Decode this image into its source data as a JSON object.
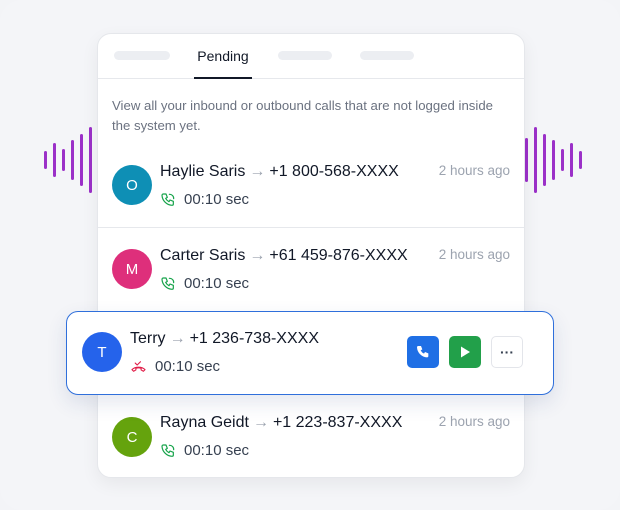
{
  "tabs": {
    "active_label": "Pending"
  },
  "description": "View all your inbound or outbound calls that are not logged inside the system yet.",
  "calls": [
    {
      "initial": "O",
      "name": "Haylie Saris",
      "arrow": "→",
      "number": "+1 800-568-XXXX",
      "duration": "00:10 sec",
      "time": "2 hours ago",
      "avatar_color": "#0e8fb5",
      "call_icon": "phone-call-icon",
      "icon_color": "#16a34a"
    },
    {
      "initial": "M",
      "name": "Carter Saris",
      "arrow": "→",
      "number": "+61 459-876-XXXX",
      "duration": "00:10 sec",
      "time": "2 hours ago",
      "avatar_color": "#de2f7b",
      "call_icon": "phone-call-icon",
      "icon_color": "#16a34a"
    },
    {
      "initial": "T",
      "name": "Terry",
      "arrow": "→",
      "number": "+1 236-738-XXXX",
      "duration": "00:10 sec",
      "avatar_color": "#2563eb",
      "call_icon": "missed-call-icon",
      "icon_color": "#e11d48"
    },
    {
      "initial": "C",
      "name": "Rayna Geidt",
      "arrow": "→",
      "number": "+1 223-837-XXXX",
      "duration": "00:10 sec",
      "time": "2 hours ago",
      "avatar_color": "#65a30d",
      "call_icon": "phone-call-icon",
      "icon_color": "#16a34a"
    }
  ],
  "actions": {
    "call_color": "#1f6fe5",
    "play_color": "#22a04a",
    "more_label": "···"
  },
  "wave_color": "#9b30c8"
}
